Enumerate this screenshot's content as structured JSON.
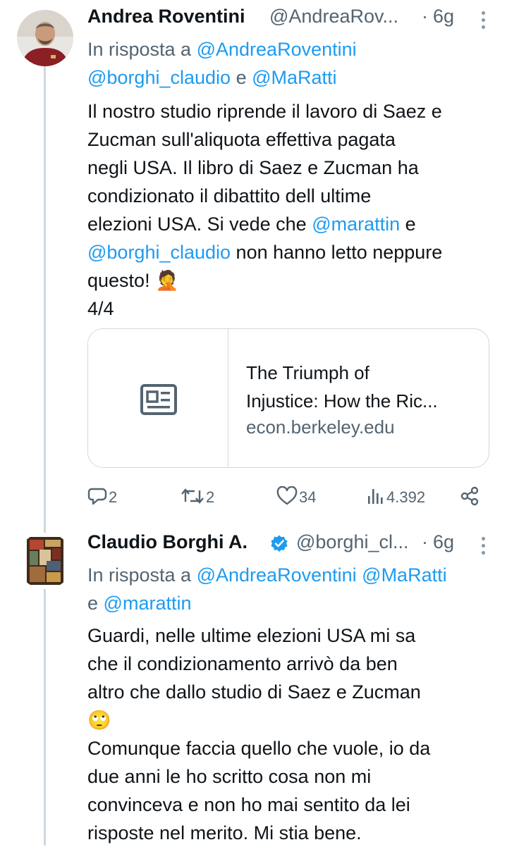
{
  "tweet1": {
    "author_name": "Andrea Roventini",
    "handle": "@AndreaRov...",
    "separator": "·",
    "time": "6g",
    "reply_prefix": "In risposta a",
    "reply_mention_1": "@AndreaRoventini",
    "reply_mention_2": "@borghi_claudio",
    "reply_and": "e",
    "reply_mention_3": "@MaRatti",
    "body_lines": [
      "Il nostro studio riprende il lavoro di Saez e",
      "Zucman sull'aliquota effettiva pagata",
      "negli USA. Il libro di Saez e Zucman ha",
      "condizionato il dibattito dell ultime"
    ],
    "body_line5_text": "elezioni USA. Si vede che ",
    "body_line5_mention": "@marattin",
    "body_line5_tail": " e",
    "body_line6_mention": "@borghi_claudio",
    "body_line6_tail": " non hanno letto neppure",
    "body_line7": "questo! 🤦",
    "body_line8": "4/4",
    "card": {
      "title_line1": "The Triumph of",
      "title_line2": "Injustice: How the Ric...",
      "domain": "econ.berkeley.edu",
      "thumb_icon": "article-icon"
    },
    "actions": {
      "replies": "2",
      "retweets": "2",
      "likes": "34",
      "views": "4.392",
      "icons": [
        "reply-icon",
        "retweet-icon",
        "like-icon",
        "views-icon",
        "share-icon"
      ]
    }
  },
  "tweet2": {
    "author_name": "Claudio Borghi A.",
    "handle": "@borghi_cl...",
    "separator": "·",
    "time": "6g",
    "verified_color": "#1d9bf0",
    "reply_prefix": "In risposta a",
    "reply_mention_1": "@AndreaRoventini",
    "reply_mention_2": "@MaRatti",
    "reply_and": "e",
    "reply_mention_3": "@marattin",
    "body_lines": [
      "Guardi, nelle ultime elezioni USA mi sa",
      "che il condizionamento arrivò da ben",
      "altro che dallo studio di Saez e Zucman",
      "🙄",
      "Comunque faccia quello che vuole, io da",
      "due anni le ho scritto cosa non mi",
      "convinceva e non ho mai sentito da lei",
      "risposte nel merito. Mi stia bene."
    ]
  },
  "colors": {
    "link": "#1d9bf0",
    "secondary_text": "#536471",
    "primary_text": "#0f1419",
    "border": "#cfd9de"
  }
}
